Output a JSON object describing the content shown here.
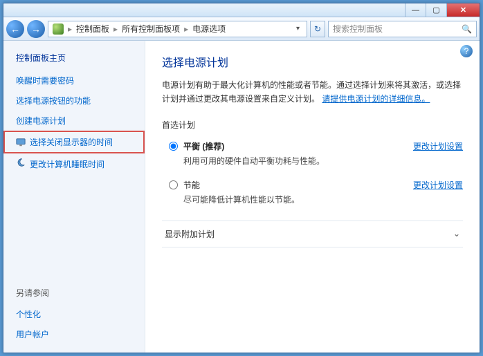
{
  "titlebar": {
    "min": "—",
    "max": "▢",
    "close": "✕"
  },
  "nav": {
    "back": "←",
    "fwd": "→",
    "crumb1": "控制面板",
    "crumb2": "所有控制面板项",
    "crumb3": "电源选项",
    "sep": "▸",
    "drop": "▾",
    "refresh": "↻",
    "search_placeholder": "搜索控制面板",
    "sicon": "🔍"
  },
  "sidebar": {
    "home": "控制面板主页",
    "links": {
      "l1": "唤醒时需要密码",
      "l2": "选择电源按钮的功能",
      "l3": "创建电源计划",
      "l4": "选择关闭显示器的时间",
      "l5": "更改计算机睡眠时间"
    },
    "see": "另请参阅",
    "see1": "个性化",
    "see2": "用户帐户"
  },
  "main": {
    "help": "?",
    "title": "选择电源计划",
    "desc1": "电源计划有助于最大化计算机的性能或者节能。通过选择计划来将其激活，或选择计划并通过更改其电源设置来自定义计划。",
    "desc_link": "请提供电源计划的详细信息。",
    "section": "首选计划",
    "plan1": {
      "name": "平衡 (推荐)",
      "desc": "利用可用的硬件自动平衡功耗与性能。",
      "change": "更改计划设置"
    },
    "plan2": {
      "name": "节能",
      "desc": "尽可能降低计算机性能以节能。",
      "change": "更改计划设置"
    },
    "expand": "显示附加计划",
    "chev": "⌄"
  }
}
